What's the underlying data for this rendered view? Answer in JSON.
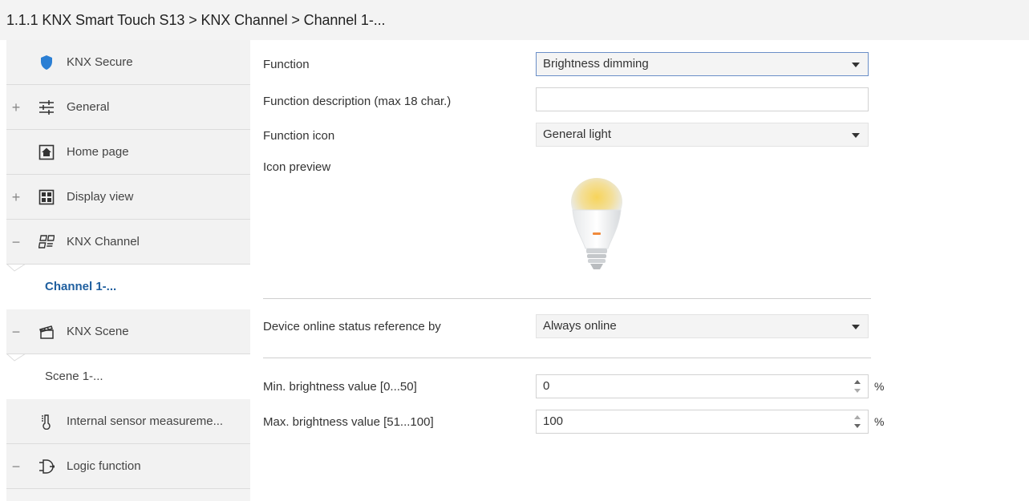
{
  "header": {
    "breadcrumb": "1.1.1 KNX Smart Touch S13 > KNX Channel  > Channel 1-..."
  },
  "sidebar": {
    "items": [
      {
        "label": "KNX Secure",
        "toggle": "",
        "icon": "shield-icon"
      },
      {
        "label": "General",
        "toggle": "+",
        "icon": "sliders-icon"
      },
      {
        "label": "Home page",
        "toggle": "",
        "icon": "home-icon"
      },
      {
        "label": "Display view",
        "toggle": "+",
        "icon": "grid-icon"
      },
      {
        "label": "KNX Channel",
        "toggle": "−",
        "icon": "channel-icon"
      },
      {
        "label": "Channel 1-...",
        "toggle": "",
        "icon": ""
      },
      {
        "label": "KNX Scene",
        "toggle": "−",
        "icon": "clapperboard-icon"
      },
      {
        "label": "Scene 1-...",
        "toggle": "",
        "icon": ""
      },
      {
        "label": "Internal sensor measureme...",
        "toggle": "",
        "icon": "thermometer-icon"
      },
      {
        "label": "Logic function",
        "toggle": "−",
        "icon": "logic-icon"
      }
    ]
  },
  "form": {
    "function_label": "Function",
    "function_value": "Brightness dimming",
    "description_label": "Function description (max 18 char.)",
    "description_value": "",
    "icon_label": "Function icon",
    "icon_value": "General light",
    "preview_label": "Icon preview",
    "preview_icon": "light-bulb-icon",
    "online_label": "Device online status reference by",
    "online_value": "Always online",
    "min_label": "Min. brightness value [0...50]",
    "min_value": "0",
    "min_unit": "%",
    "max_label": "Max. brightness value [51...100]",
    "max_value": "100",
    "max_unit": "%"
  },
  "colors": {
    "accent": "#1f5f9f",
    "shield": "#2b7fd4",
    "bulb_glow": "#f2c84b"
  }
}
